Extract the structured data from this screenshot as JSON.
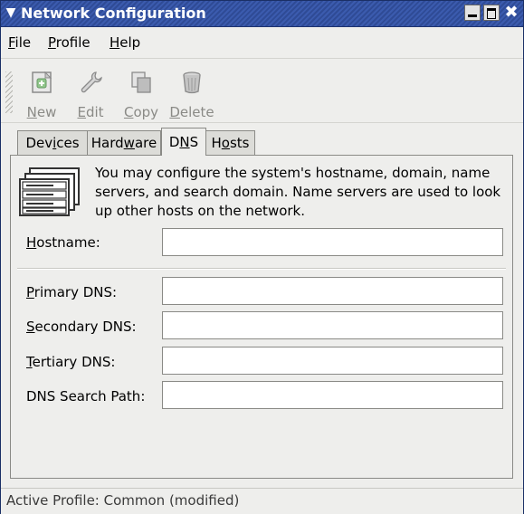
{
  "window": {
    "title": "Network Configuration",
    "accent": "#3b5bae",
    "controls": [
      "minimize-icon",
      "maximize-icon",
      "close-icon"
    ]
  },
  "menubar": {
    "items": [
      {
        "pre": "",
        "mnemonic": "F",
        "post": "ile"
      },
      {
        "pre": "",
        "mnemonic": "P",
        "post": "rofile"
      },
      {
        "pre": "",
        "mnemonic": "H",
        "post": "elp"
      }
    ]
  },
  "toolbar": {
    "items": [
      {
        "pre": "",
        "mnemonic": "N",
        "post": "ew",
        "icon": "new-icon"
      },
      {
        "pre": "",
        "mnemonic": "E",
        "post": "dit",
        "icon": "wrench-icon"
      },
      {
        "pre": "",
        "mnemonic": "C",
        "post": "opy",
        "icon": "copy-icon"
      },
      {
        "pre": "",
        "mnemonic": "D",
        "post": "elete",
        "icon": "trash-icon"
      }
    ]
  },
  "tabs": [
    {
      "pre": "Dev",
      "mnemonic": "i",
      "post": "ces"
    },
    {
      "pre": "Hard",
      "mnemonic": "w",
      "post": "are"
    },
    {
      "pre": "D",
      "mnemonic": "N",
      "post": "S",
      "active": true
    },
    {
      "pre": "H",
      "mnemonic": "o",
      "post": "sts"
    }
  ],
  "dns": {
    "description": "You may configure the system's hostname, domain, name servers, and search domain. Name servers are used to look up other hosts on the network.",
    "fields": [
      {
        "pre": "",
        "mnemonic": "H",
        "post": "ostname:",
        "value": ""
      },
      {
        "pre": "",
        "mnemonic": "P",
        "post": "rimary DNS:",
        "value": ""
      },
      {
        "pre": "",
        "mnemonic": "S",
        "post": "econdary DNS:",
        "value": ""
      },
      {
        "pre": "",
        "mnemonic": "T",
        "post": "ertiary DNS:",
        "value": ""
      },
      {
        "pre": "DNS Search Path:",
        "mnemonic": "",
        "post": "",
        "value": ""
      }
    ]
  },
  "status": {
    "text": "Active Profile: Common (modified)"
  }
}
